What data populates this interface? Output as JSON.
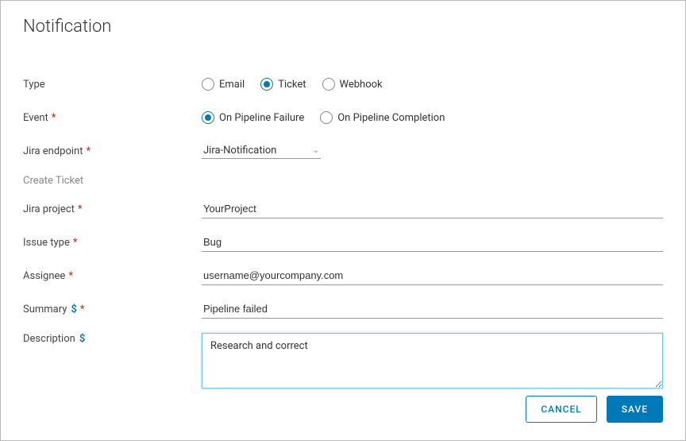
{
  "title": "Notification",
  "labels": {
    "type": "Type",
    "event": "Event",
    "jiraEndpoint": "Jira endpoint",
    "createTicket": "Create Ticket",
    "jiraProject": "Jira project",
    "issueType": "Issue type",
    "assignee": "Assignee",
    "summary": "Summary",
    "description": "Description"
  },
  "typeOptions": {
    "email": "Email",
    "ticket": "Ticket",
    "webhook": "Webhook",
    "selected": "ticket"
  },
  "eventOptions": {
    "failure": "On Pipeline Failure",
    "completion": "On Pipeline Completion",
    "selected": "failure"
  },
  "endpoint": {
    "value": "Jira-Notification"
  },
  "fields": {
    "jiraProject": "YourProject",
    "issueType": "Bug",
    "assignee": "username@yourcompany.com",
    "summary": "Pipeline failed",
    "description": "Research and correct"
  },
  "buttons": {
    "cancel": "CANCEL",
    "save": "SAVE"
  }
}
